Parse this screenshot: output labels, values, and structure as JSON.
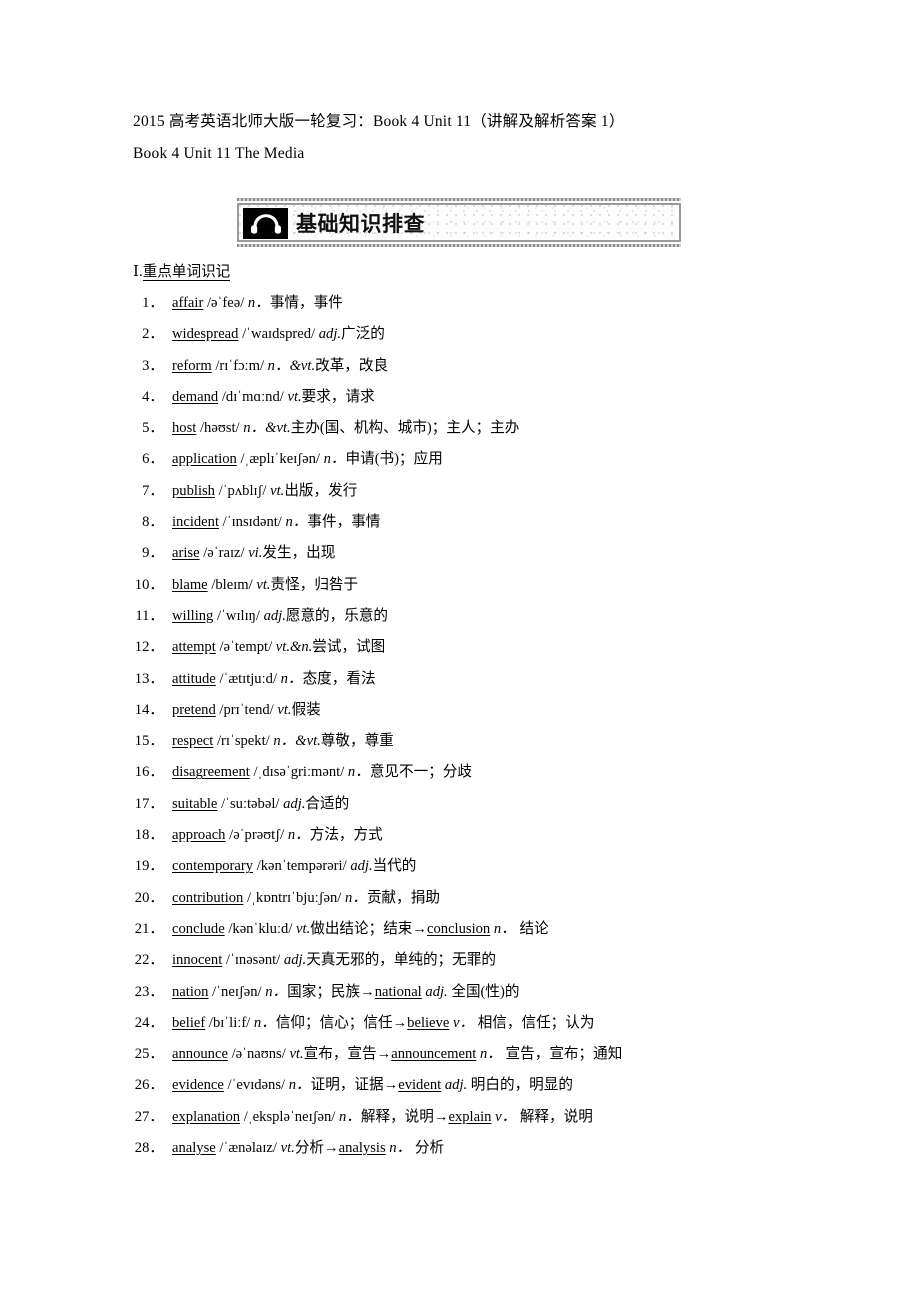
{
  "document": {
    "title": "2015 高考英语北师大版一轮复习：Book 4 Unit 11（讲解及解析答案 1）",
    "subtitle": "Book 4 Unit 11 The Media"
  },
  "banner": {
    "icon": "headphones-icon",
    "title": "基础知识排查",
    "border_color": "#9a9a9a",
    "icon_bg_color": "#000000"
  },
  "section": {
    "number": "Ⅰ",
    "separator": ".",
    "heading": "重点单词识记"
  },
  "vocabulary": [
    {
      "num": "1．",
      "word": "affair",
      "phonetic": "/əˈfeə/",
      "pos": "n．",
      "meaning": "事情，事件",
      "derived_word": "",
      "derived_pos": "",
      "derived_meaning": ""
    },
    {
      "num": "2．",
      "word": "widespread",
      "phonetic": "/ˈwaɪdspred/",
      "pos": "adj.",
      "meaning": "广泛的",
      "derived_word": "",
      "derived_pos": "",
      "derived_meaning": ""
    },
    {
      "num": "3．",
      "word": "reform",
      "phonetic": "/rɪˈfɔːm/",
      "pos": "n．&vt.",
      "meaning": "改革，改良",
      "derived_word": "",
      "derived_pos": "",
      "derived_meaning": ""
    },
    {
      "num": "4．",
      "word": "demand",
      "phonetic": "/dɪˈmɑːnd/",
      "pos": "vt.",
      "meaning": "要求，请求",
      "derived_word": "",
      "derived_pos": "",
      "derived_meaning": ""
    },
    {
      "num": "5．",
      "word": "host",
      "phonetic": "/həʊst/",
      "pos": "n．&vt.",
      "meaning": "主办(国、机构、城市)；主人；主办",
      "derived_word": "",
      "derived_pos": "",
      "derived_meaning": ""
    },
    {
      "num": "6．",
      "word": "application",
      "phonetic": "/ˌæplɪˈkeɪʃən/",
      "pos": "n．",
      "meaning": "申请(书)；应用",
      "derived_word": "",
      "derived_pos": "",
      "derived_meaning": ""
    },
    {
      "num": "7．",
      "word": "publish",
      "phonetic": "/ˈpʌblɪʃ/",
      "pos": "vt.",
      "meaning": "出版，发行",
      "derived_word": "",
      "derived_pos": "",
      "derived_meaning": ""
    },
    {
      "num": "8．",
      "word": "incident",
      "phonetic": "/ˈɪnsɪdənt/",
      "pos": "n．",
      "meaning": "事件，事情",
      "derived_word": "",
      "derived_pos": "",
      "derived_meaning": ""
    },
    {
      "num": "9．",
      "word": "arise",
      "phonetic": "/əˈraɪz/",
      "pos": "vi.",
      "meaning": "发生，出现",
      "derived_word": "",
      "derived_pos": "",
      "derived_meaning": ""
    },
    {
      "num": "10．",
      "word": "blame",
      "phonetic": "/bleɪm/",
      "pos": "vt.",
      "meaning": "责怪，归咎于",
      "derived_word": "",
      "derived_pos": "",
      "derived_meaning": ""
    },
    {
      "num": "11．",
      "word": "willing",
      "phonetic": "/ˈwɪlɪŋ/",
      "pos": "adj.",
      "meaning": "愿意的，乐意的",
      "derived_word": "",
      "derived_pos": "",
      "derived_meaning": ""
    },
    {
      "num": "12．",
      "word": "attempt",
      "phonetic": "/əˈtempt/",
      "pos": "vt.&n.",
      "meaning": "尝试，试图",
      "derived_word": "",
      "derived_pos": "",
      "derived_meaning": ""
    },
    {
      "num": "13．",
      "word": "attitude",
      "phonetic": "/ˈætɪtjuːd/",
      "pos": "n．",
      "meaning": "态度，看法",
      "derived_word": "",
      "derived_pos": "",
      "derived_meaning": ""
    },
    {
      "num": "14．",
      "word": "pretend",
      "phonetic": "/prɪˈtend/",
      "pos": "vt.",
      "meaning": "假装",
      "derived_word": "",
      "derived_pos": "",
      "derived_meaning": ""
    },
    {
      "num": "15．",
      "word": "respect",
      "phonetic": "/rɪˈspekt/",
      "pos": "n．&vt.",
      "meaning": "尊敬，尊重",
      "derived_word": "",
      "derived_pos": "",
      "derived_meaning": ""
    },
    {
      "num": "16．",
      "word": "disagreement",
      "phonetic": "/ˌdɪsəˈgriːmənt/",
      "pos": "n．",
      "meaning": "意见不一；分歧",
      "derived_word": "",
      "derived_pos": "",
      "derived_meaning": ""
    },
    {
      "num": "17．",
      "word": "suitable",
      "phonetic": "/ˈsuːtəbəl/",
      "pos": "adj.",
      "meaning": "合适的",
      "derived_word": "",
      "derived_pos": "",
      "derived_meaning": ""
    },
    {
      "num": "18．",
      "word": "approach",
      "phonetic": "/əˈprəʊtʃ/",
      "pos": "n．",
      "meaning": "方法，方式",
      "derived_word": "",
      "derived_pos": "",
      "derived_meaning": ""
    },
    {
      "num": "19．",
      "word": "contemporary",
      "phonetic": "/kənˈtempərəri/",
      "pos": "adj.",
      "meaning": "当代的",
      "derived_word": "",
      "derived_pos": "",
      "derived_meaning": ""
    },
    {
      "num": "20．",
      "word": "contribution",
      "phonetic": "/ˌkɒntrɪˈbjuːʃən/",
      "pos": "n．",
      "meaning": "贡献，捐助",
      "derived_word": "",
      "derived_pos": "",
      "derived_meaning": ""
    },
    {
      "num": "21．",
      "word": "conclude",
      "phonetic": "/kənˈkluːd/",
      "pos": "vt.",
      "meaning": "做出结论；结束",
      "derived_word": "conclusion",
      "derived_pos": "n．",
      "derived_meaning": "结论"
    },
    {
      "num": "22．",
      "word": "innocent",
      "phonetic": "/ˈɪnəsənt/",
      "pos": "adj.",
      "meaning": "天真无邪的，单纯的；无罪的",
      "derived_word": "",
      "derived_pos": "",
      "derived_meaning": ""
    },
    {
      "num": "23．",
      "word": "nation",
      "phonetic": "/ˈneɪʃən/",
      "pos": "n．",
      "meaning": "国家；民族",
      "derived_word": "national",
      "derived_pos": "adj.",
      "derived_meaning": "全国(性)的"
    },
    {
      "num": "24．",
      "word": "belief",
      "phonetic": "/bɪˈliːf/",
      "pos": "n．",
      "meaning": "信仰；信心；信任",
      "derived_word": "believe",
      "derived_pos": "v．",
      "derived_meaning": "相信，信任；认为"
    },
    {
      "num": "25．",
      "word": "announce",
      "phonetic": "/əˈnaʊns/",
      "pos": "vt.",
      "meaning": "宣布，宣告",
      "derived_word": "announcement",
      "derived_pos": "n．",
      "derived_meaning": "宣告，宣布；通知"
    },
    {
      "num": "26．",
      "word": "evidence",
      "phonetic": "/ˈevɪdəns/",
      "pos": "n．",
      "meaning": "证明，证据",
      "derived_word": "evident",
      "derived_pos": "adj.",
      "derived_meaning": "明白的，明显的"
    },
    {
      "num": "27．",
      "word": "explanation",
      "phonetic": "/ˌekspləˈneɪʃən/",
      "pos": "n．",
      "meaning": "解释，说明",
      "derived_word": "explain",
      "derived_pos": "v．",
      "derived_meaning": "解释，说明"
    },
    {
      "num": "28．",
      "word": "analyse",
      "phonetic": "/ˈænəlaɪz/",
      "pos": "vt.",
      "meaning": "分析",
      "derived_word": "analysis",
      "derived_pos": "n．",
      "derived_meaning": "分析"
    }
  ],
  "symbols": {
    "arrow": "→"
  }
}
